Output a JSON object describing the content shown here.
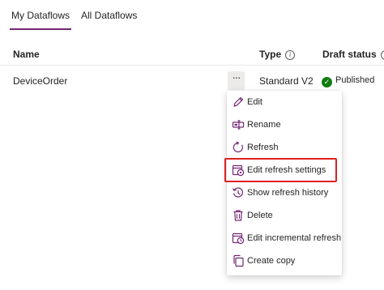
{
  "tabs": [
    {
      "label": "My Dataflows",
      "active": true
    },
    {
      "label": "All Dataflows",
      "active": false
    }
  ],
  "table": {
    "headers": {
      "name": "Name",
      "type": "Type",
      "draft_status": "Draft status"
    },
    "rows": [
      {
        "name": "DeviceOrder",
        "more": "···",
        "type": "Standard V2",
        "status": "Published"
      }
    ]
  },
  "menu": {
    "items": [
      {
        "label": "Edit",
        "icon": "pencil-icon"
      },
      {
        "label": "Rename",
        "icon": "rename-icon"
      },
      {
        "label": "Refresh",
        "icon": "refresh-icon"
      },
      {
        "label": "Edit refresh settings",
        "icon": "calendar-settings-icon",
        "highlighted": true
      },
      {
        "label": "Show refresh history",
        "icon": "history-icon"
      },
      {
        "label": "Delete",
        "icon": "trash-icon"
      },
      {
        "label": "Edit incremental refresh",
        "icon": "calendar-refresh-icon"
      },
      {
        "label": "Create copy",
        "icon": "copy-icon"
      }
    ]
  },
  "colors": {
    "accent": "#742774",
    "highlight_border": "#e02020",
    "status_green": "#107c10"
  }
}
